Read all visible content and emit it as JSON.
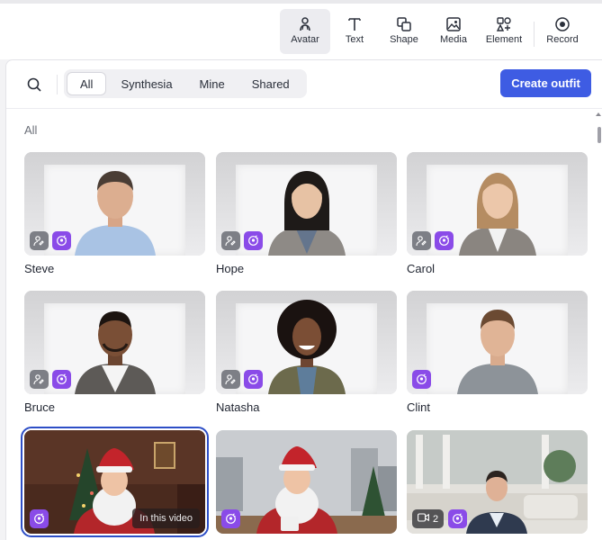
{
  "toolbar": {
    "items": [
      {
        "label": "Avatar",
        "icon": "avatar-icon",
        "active": true
      },
      {
        "label": "Text",
        "icon": "text-icon"
      },
      {
        "label": "Shape",
        "icon": "shape-icon"
      },
      {
        "label": "Media",
        "icon": "media-icon"
      },
      {
        "label": "Element",
        "icon": "element-icon"
      },
      {
        "label": "Record",
        "icon": "record-icon"
      }
    ]
  },
  "panel": {
    "tabs": [
      "All",
      "Synthesia",
      "Mine",
      "Shared"
    ],
    "active_tab": "All",
    "create_button": "Create outfit",
    "section_label": "All"
  },
  "avatars": [
    {
      "name": "Steve"
    },
    {
      "name": "Hope"
    },
    {
      "name": "Carol"
    },
    {
      "name": "Bruce"
    },
    {
      "name": "Natasha"
    },
    {
      "name": "Clint"
    },
    {
      "name": "",
      "tag": "In this video",
      "selected": true
    },
    {
      "name": ""
    },
    {
      "name": "",
      "count": "2"
    }
  ],
  "colors": {
    "accent": "#3e5ce3",
    "badge_purple": "#8a4be8",
    "badge_gray": "#7d7f86",
    "selected_outline": "#2d4ec6"
  }
}
